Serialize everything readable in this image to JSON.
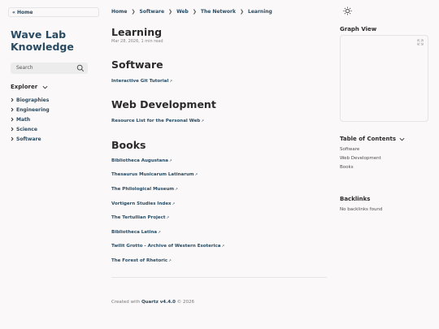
{
  "sidebar": {
    "home_label": "« Home",
    "site_title_line1": "Wave Lab",
    "site_title_line2": "Knowledge",
    "search_placeholder": "Search",
    "explorer_label": "Explorer",
    "folders": [
      "Biographies",
      "Engineering",
      "Math",
      "Science",
      "Software"
    ]
  },
  "breadcrumb": [
    "Home",
    "Software",
    "Web",
    "The Network",
    "Learning"
  ],
  "breadcrumb_separator": "❯",
  "page": {
    "title": "Learning",
    "date": "Mar 28, 2026",
    "dot": ",",
    "read_time": "1 min read"
  },
  "sections": {
    "software": {
      "heading": "Software",
      "links": [
        "Interactive Git Tutorial"
      ]
    },
    "webdev": {
      "heading": "Web Development",
      "links": [
        "Resource List for the Personal Web"
      ]
    },
    "books": {
      "heading": "Books",
      "links": [
        "Bibliotheca Augustana",
        "Thesaurus Musicarum Latinarum",
        "The Philological Museum",
        "Vortigern Studies Index",
        "The Tertullian Project",
        "Bibliotheca Latina",
        "Twilit Grotto - Archive of Western Esoterica",
        "The Forest of Rhetoric"
      ]
    }
  },
  "external_link_glyph": "↗",
  "footer": {
    "prefix": "Created with",
    "link": "Quartz v4.4.0",
    "suffix": "© 2026"
  },
  "right": {
    "graph_title": "Graph View",
    "toc_title": "Table of Contents",
    "toc_items": [
      "Software",
      "Web Development",
      "Books"
    ],
    "backlinks_title": "Backlinks",
    "backlinks_empty": "No backlinks found"
  }
}
